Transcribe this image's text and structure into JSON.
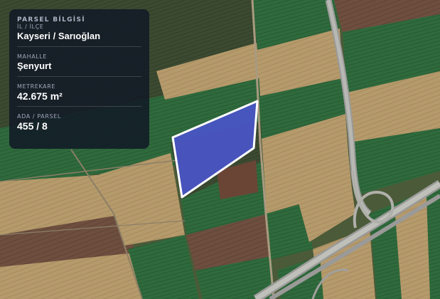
{
  "panel": {
    "title": "PARSEL BİLGİSİ",
    "fields": [
      {
        "label": "İL / İLÇE",
        "value": "Kayseri / Sarıoğlan"
      },
      {
        "label": "MAHALLE",
        "value": "Şenyurt"
      },
      {
        "label": "METREKARE",
        "value": "42.675 m²"
      },
      {
        "label": "ADA / PARSEL",
        "value": "455 / 8"
      }
    ]
  },
  "colors": {
    "parcel_fill": "#4a55c8",
    "parcel_stroke": "#ffffff",
    "panel_bg": "#121826"
  }
}
